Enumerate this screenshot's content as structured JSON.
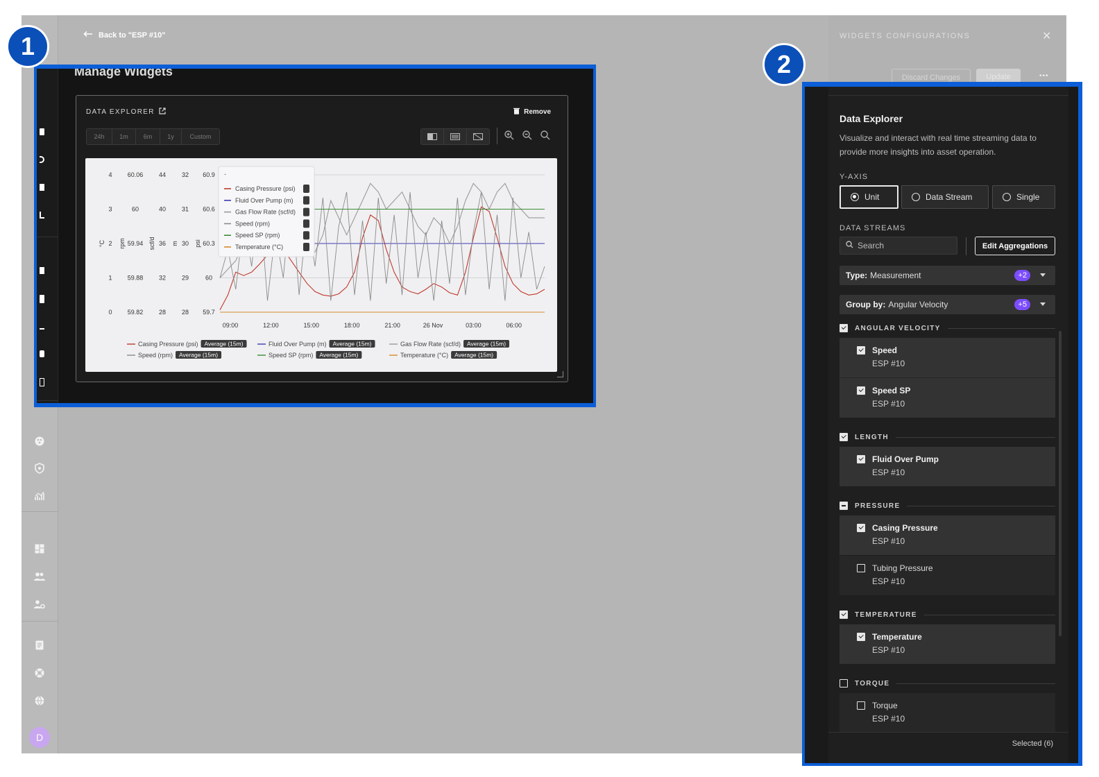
{
  "header": {
    "back_label": "Back to \"ESP #10\""
  },
  "page": {
    "title": "Manage Widgets"
  },
  "config": {
    "title": "WIDGETS CONFIGURATIONS",
    "discard_label": "Discard Changes",
    "update_label": "Update",
    "more_label": "•••"
  },
  "badges": {
    "one": "1",
    "two": "2"
  },
  "user": {
    "avatar_letter": "D"
  },
  "widget": {
    "title": "DATA EXPLORER",
    "remove_label": "Remove",
    "timeframes": [
      "24h",
      "1m",
      "6m",
      "1y",
      "Custom"
    ]
  },
  "chart_data": {
    "type": "line",
    "x_ticks": [
      "09:00",
      "12:00",
      "15:00",
      "18:00",
      "21:00",
      "26 Nov",
      "03:00",
      "06:00"
    ],
    "axes": [
      {
        "label": "°C",
        "ticks": [
          "4",
          "3",
          "2",
          "1",
          "0"
        ],
        "ylim": [
          0,
          4
        ]
      },
      {
        "label": "rpm",
        "ticks": [
          "60.06",
          "60",
          "59.94",
          "59.88",
          "59.82"
        ],
        "ylim": [
          59.82,
          60.06
        ]
      },
      {
        "label": "scf/d",
        "ticks": [
          "44",
          "40",
          "36",
          "32",
          "28"
        ],
        "ylim": [
          28,
          44
        ]
      },
      {
        "label": "m",
        "ticks": [
          "32",
          "31",
          "30",
          "29",
          "28"
        ],
        "ylim": [
          28,
          32
        ]
      },
      {
        "label": "psi",
        "ticks": [
          "60.9",
          "60.6",
          "60.3",
          "60",
          "59.7"
        ],
        "ylim": [
          59.7,
          60.9
        ]
      }
    ],
    "series": [
      {
        "name": "Casing Pressure (psi)",
        "color": "#c0392b",
        "aggregation": "Average (15m)",
        "values": [
          59.72,
          59.85,
          60.05,
          60.02,
          60.05,
          60.12,
          60.2,
          60.3,
          60.25,
          60.15,
          60.05,
          59.95,
          59.88,
          59.85,
          59.84,
          59.86,
          59.92,
          60.05,
          60.35,
          60.55,
          60.5,
          60.25,
          60.05,
          59.92,
          59.88,
          59.86,
          59.9,
          59.95,
          59.92,
          59.87,
          59.85,
          60.05,
          60.35,
          60.62,
          60.58,
          60.35,
          60.1,
          59.95,
          59.88,
          59.85,
          59.86,
          59.9
        ]
      },
      {
        "name": "Fluid Over Pump (m)",
        "color": "#3b3bb5",
        "aggregation": "Average (15m)",
        "values": [
          30,
          30,
          30,
          30,
          30,
          30,
          30,
          30,
          30,
          30,
          30,
          30,
          30,
          30,
          30,
          30,
          30,
          30,
          30,
          30,
          30,
          30,
          30,
          30,
          30,
          30,
          30,
          30,
          30,
          30,
          30,
          30,
          30,
          30,
          30,
          30,
          30,
          30,
          30,
          30,
          30,
          30
        ]
      },
      {
        "name": "Gas Flow Rate (scf/d)",
        "color": "#9a9a9a",
        "aggregation": "Average (15m)",
        "values": [
          32,
          33,
          34,
          36,
          35,
          37,
          38,
          37,
          39,
          40,
          38,
          36,
          35,
          37,
          41,
          39,
          37,
          39,
          41,
          43,
          42,
          40,
          41,
          42,
          40,
          38,
          37,
          39,
          38,
          36,
          38,
          41,
          43,
          42,
          40,
          42,
          43,
          41,
          40,
          39,
          39,
          39
        ]
      },
      {
        "name": "Speed (rpm)",
        "color": "#8a8a8a",
        "aggregation": "Average (15m)",
        "values": [
          59.88,
          59.93,
          59.86,
          59.98,
          59.9,
          60.02,
          59.84,
          59.96,
          59.88,
          60.03,
          59.85,
          59.99,
          59.9,
          60.02,
          59.84,
          59.97,
          60.03,
          59.85,
          59.98,
          59.84,
          60.02,
          59.87,
          59.99,
          59.85,
          60.03,
          59.88,
          59.96,
          59.84,
          59.98,
          59.87,
          60.02,
          59.85,
          59.96,
          60.03,
          59.86,
          59.99,
          59.84,
          60.02,
          59.88,
          59.96,
          59.86,
          59.9
        ]
      },
      {
        "name": "Speed SP (rpm)",
        "color": "#3d8b37",
        "aggregation": "Average (15m)",
        "values": [
          60,
          60,
          60,
          60,
          60,
          60,
          60,
          60,
          60,
          60,
          60,
          60,
          60,
          60,
          60,
          60,
          60,
          60,
          60,
          60,
          60,
          60,
          60,
          60,
          60,
          60,
          60,
          60,
          60,
          60,
          60,
          60,
          60,
          60,
          60,
          60,
          60,
          60,
          60,
          60,
          60,
          60
        ]
      },
      {
        "name": "Temperature (°C)",
        "color": "#d68a2e",
        "aggregation": "Average (15m)",
        "values": [
          0,
          0,
          0,
          0,
          0,
          0,
          0,
          0,
          0,
          0,
          0,
          0,
          0,
          0,
          0,
          0,
          0,
          0,
          0,
          0,
          0,
          0,
          0,
          0,
          0,
          0,
          0,
          0,
          0,
          0,
          0,
          0,
          0,
          0,
          0,
          0,
          0,
          0,
          0,
          0,
          0,
          0
        ]
      }
    ]
  },
  "panel": {
    "title": "Data Explorer",
    "description": "Visualize and interact with real time streaming data to provide more insights into asset operation.",
    "yaxis_label": "Y-AXIS",
    "yaxis_options": [
      "Unit",
      "Data Stream",
      "Single"
    ],
    "yaxis_selected": "Unit",
    "streams_label": "DATA STREAMS",
    "search_placeholder": "Search",
    "edit_agg_label": "Edit Aggregations",
    "type_label": "Type:",
    "type_value": "Measurement",
    "type_more": "+2",
    "group_label": "Group by:",
    "group_value": "Angular Velocity",
    "group_more": "+5",
    "groups": [
      {
        "name": "ANGULAR VELOCITY",
        "state": "checked",
        "items": [
          {
            "name": "Speed",
            "source": "ESP #10",
            "checked": true
          },
          {
            "name": "Speed SP",
            "source": "ESP #10",
            "checked": true
          }
        ]
      },
      {
        "name": "LENGTH",
        "state": "checked",
        "items": [
          {
            "name": "Fluid Over Pump",
            "source": "ESP #10",
            "checked": true
          }
        ]
      },
      {
        "name": "PRESSURE",
        "state": "mixed",
        "items": [
          {
            "name": "Casing Pressure",
            "source": "ESP #10",
            "checked": true
          },
          {
            "name": "Tubing Pressure",
            "source": "ESP #10",
            "checked": false
          }
        ]
      },
      {
        "name": "TEMPERATURE",
        "state": "checked",
        "items": [
          {
            "name": "Temperature",
            "source": "ESP #10",
            "checked": true
          }
        ]
      },
      {
        "name": "TORQUE",
        "state": "unchecked",
        "items": [
          {
            "name": "Torque",
            "source": "ESP #10",
            "checked": false
          }
        ]
      }
    ],
    "selected_label": "Selected (6)"
  }
}
